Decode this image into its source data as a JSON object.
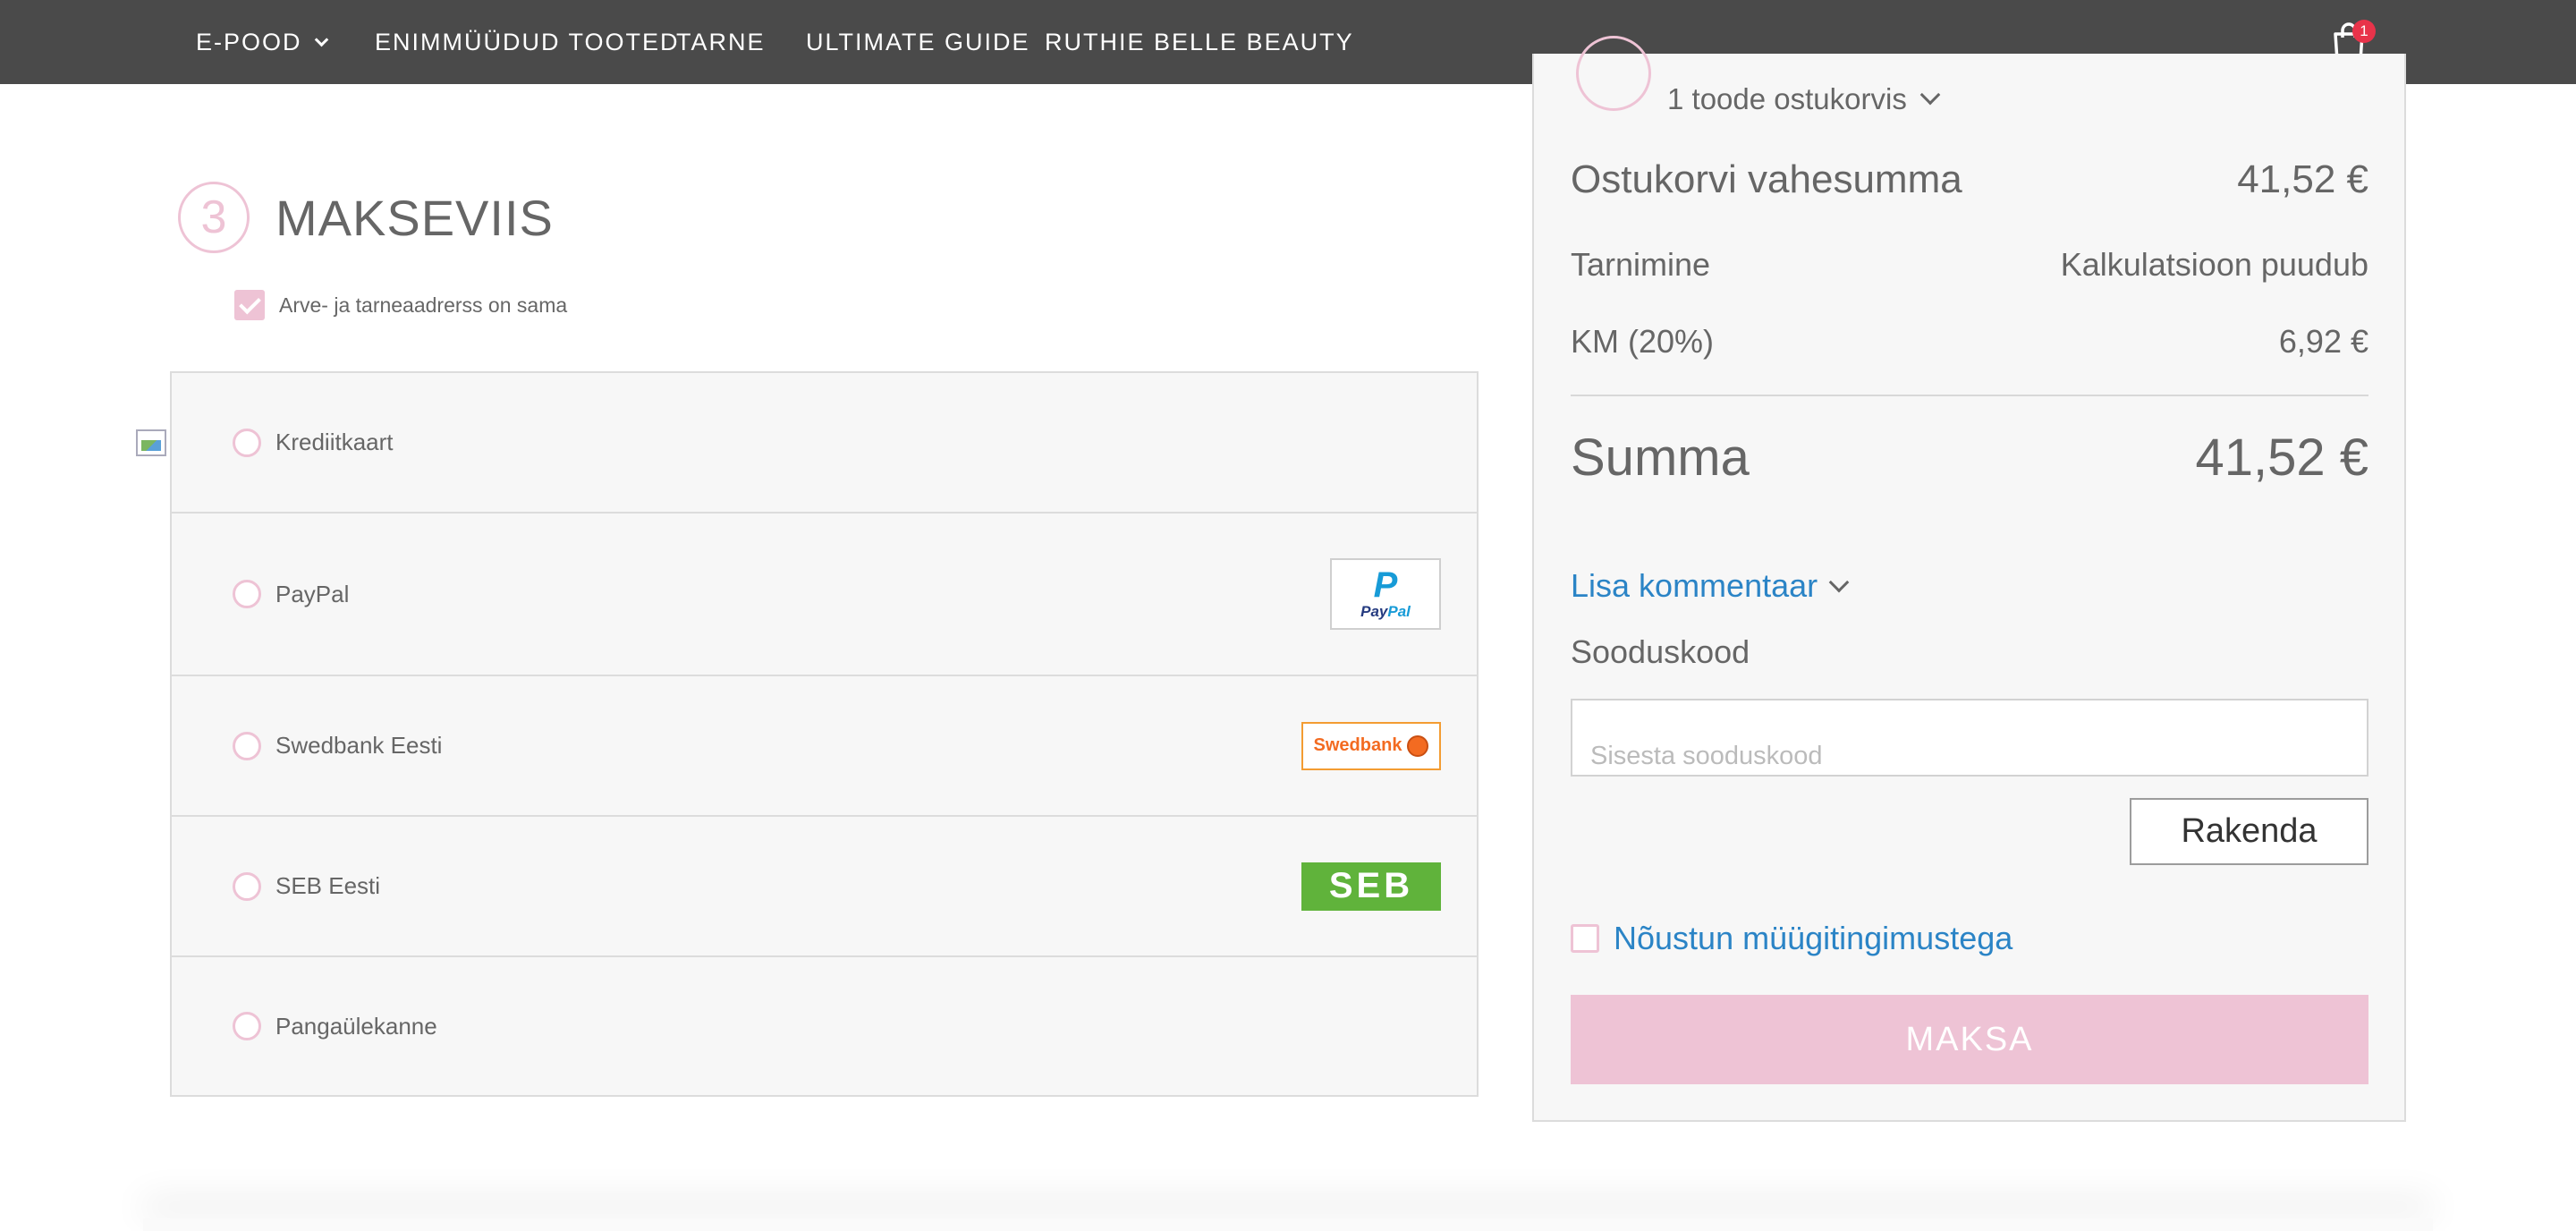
{
  "nav": {
    "items": [
      {
        "label": "E-POOD",
        "has_dropdown": true
      },
      {
        "label": "ENIMMÜÜDUD TOOTED"
      },
      {
        "label": "TARNE"
      },
      {
        "label": "ULTIMATE GUIDE"
      },
      {
        "label": "RUTHIE BELLE BEAUTY"
      }
    ],
    "cart_badge": "1"
  },
  "payment": {
    "step_number": "3",
    "title": "MAKSEVIIS",
    "same_address_label": "Arve- ja tarneaadrerss on sama",
    "same_address_checked": true,
    "methods": [
      {
        "label": "Krediitkaart",
        "logo": "broken-image-icon"
      },
      {
        "label": "PayPal",
        "logo": "paypal-logo"
      },
      {
        "label": "Swedbank Eesti",
        "logo": "swedbank-logo"
      },
      {
        "label": "SEB Eesti",
        "logo": "seb-logo"
      },
      {
        "label": "Pangaülekanne",
        "logo": ""
      }
    ],
    "logo_text": {
      "paypal_mark": "P",
      "paypal_word_1": "Pay",
      "paypal_word_2": "Pal",
      "swedbank": "Swedbank",
      "seb": "SEB"
    }
  },
  "summary": {
    "cart_count": "1 toode ostukorvis",
    "subtotal_label": "Ostukorvi vahesumma",
    "subtotal_value": "41,52 €",
    "shipping_label": "Tarnimine",
    "shipping_value": "Kalkulatsioon puudub",
    "tax_label": "KM (20%)",
    "tax_value": "6,92 €",
    "total_label": "Summa",
    "total_value": "41,52 €",
    "add_comment": "Lisa kommentaar",
    "coupon_label": "Sooduskood",
    "coupon_placeholder": "Sisesta sooduskood",
    "apply_label": "Rakenda",
    "terms_label": "Nõustun müügitingimustega",
    "pay_label": "MAKSA"
  },
  "colors": {
    "nav_bg": "#4a4a4a",
    "accent_pink": "#eec3d5",
    "link_blue": "#2b84c6"
  }
}
